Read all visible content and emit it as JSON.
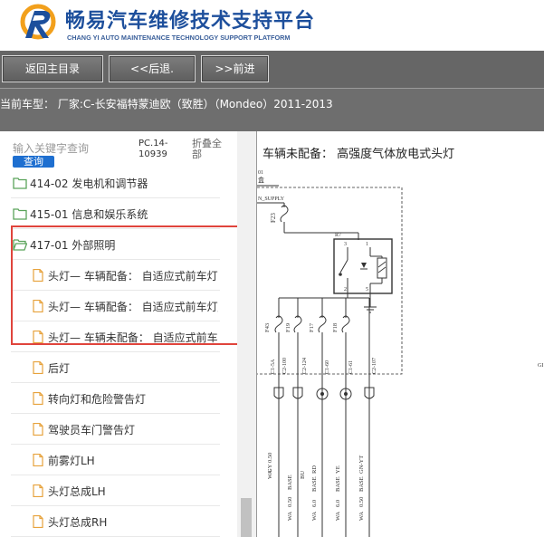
{
  "header": {
    "title_cn": "畅易汽车维修技术支持平台",
    "title_en": "CHANG YI AUTO MAINTENANCE TECHNOLOGY SUPPORT PLATFORM"
  },
  "toolbar": {
    "home": "返回主目录",
    "back": "<<后退.",
    "forward": ">>前进"
  },
  "vehicle_bar": {
    "text": "当前车型： 厂家:C-长安福特蒙迪欧（致胜）（Mondeo）2011-2013"
  },
  "sidebar": {
    "search_placeholder": "输入关键字查询",
    "search_button": "查询",
    "pc_code": "PC.14-10939",
    "collapse_all": "折叠全部",
    "items": [
      {
        "label": "414-02 发电机和调节器",
        "type": "folder"
      },
      {
        "label": "415-01 信息和娱乐系统",
        "type": "folder"
      },
      {
        "label": "417-01 外部照明",
        "type": "folder-open"
      },
      {
        "label": "头灯— 车辆配备： 自适应式前车灯, 频闪灯",
        "type": "doc"
      },
      {
        "label": "头灯— 车辆配备： 自适应式前车灯/高强度气体放电式",
        "type": "doc"
      },
      {
        "label": "头灯— 车辆未配备： 自适应式前车灯",
        "type": "doc"
      },
      {
        "label": "后灯",
        "type": "doc"
      },
      {
        "label": "转向灯和危险警告灯",
        "type": "doc"
      },
      {
        "label": "驾驶员车门警告灯",
        "type": "doc"
      },
      {
        "label": "前雾灯LH",
        "type": "doc"
      },
      {
        "label": "头灯总成LH",
        "type": "doc"
      },
      {
        "label": "头灯总成RH",
        "type": "doc"
      }
    ]
  },
  "diagram": {
    "title": "车辆未配备： 高强度气体放电式头灯",
    "supply_label": "N_SUPPLY",
    "corner_label_1": "01",
    "corner_label_2": "盒",
    "fuse_f23": "F23",
    "relay_r7": "R7",
    "relay_pins": [
      "3",
      "1",
      "2",
      "5"
    ],
    "fuses": [
      "F43",
      "F19",
      "F17",
      "F18"
    ],
    "connectors": [
      "C1-5A",
      "C2-100",
      "C2-124",
      "C1-60",
      "C1-61",
      "C2-107"
    ],
    "wire_colors": [
      "GY",
      "BU",
      "RD",
      "YE",
      "GN-YT"
    ],
    "wire_sizes": [
      "0.50",
      "0.50",
      "6.0",
      "6.0",
      "0.50"
    ],
    "wire_types": [
      "WA",
      "WA",
      "WA",
      "WA",
      "WA"
    ],
    "wire_tags": [
      "BASE",
      "BASE",
      "BASE",
      "BASE",
      "BASE"
    ],
    "right_edge_label": "GI"
  },
  "colors": {
    "brand_blue": "#1d4f9c",
    "toolbar_bg": "#666666",
    "highlight": "#e0443c",
    "search_button": "#1e6fd0",
    "folder_green": "#5aa35a",
    "doc_orange": "#e7a23c"
  }
}
